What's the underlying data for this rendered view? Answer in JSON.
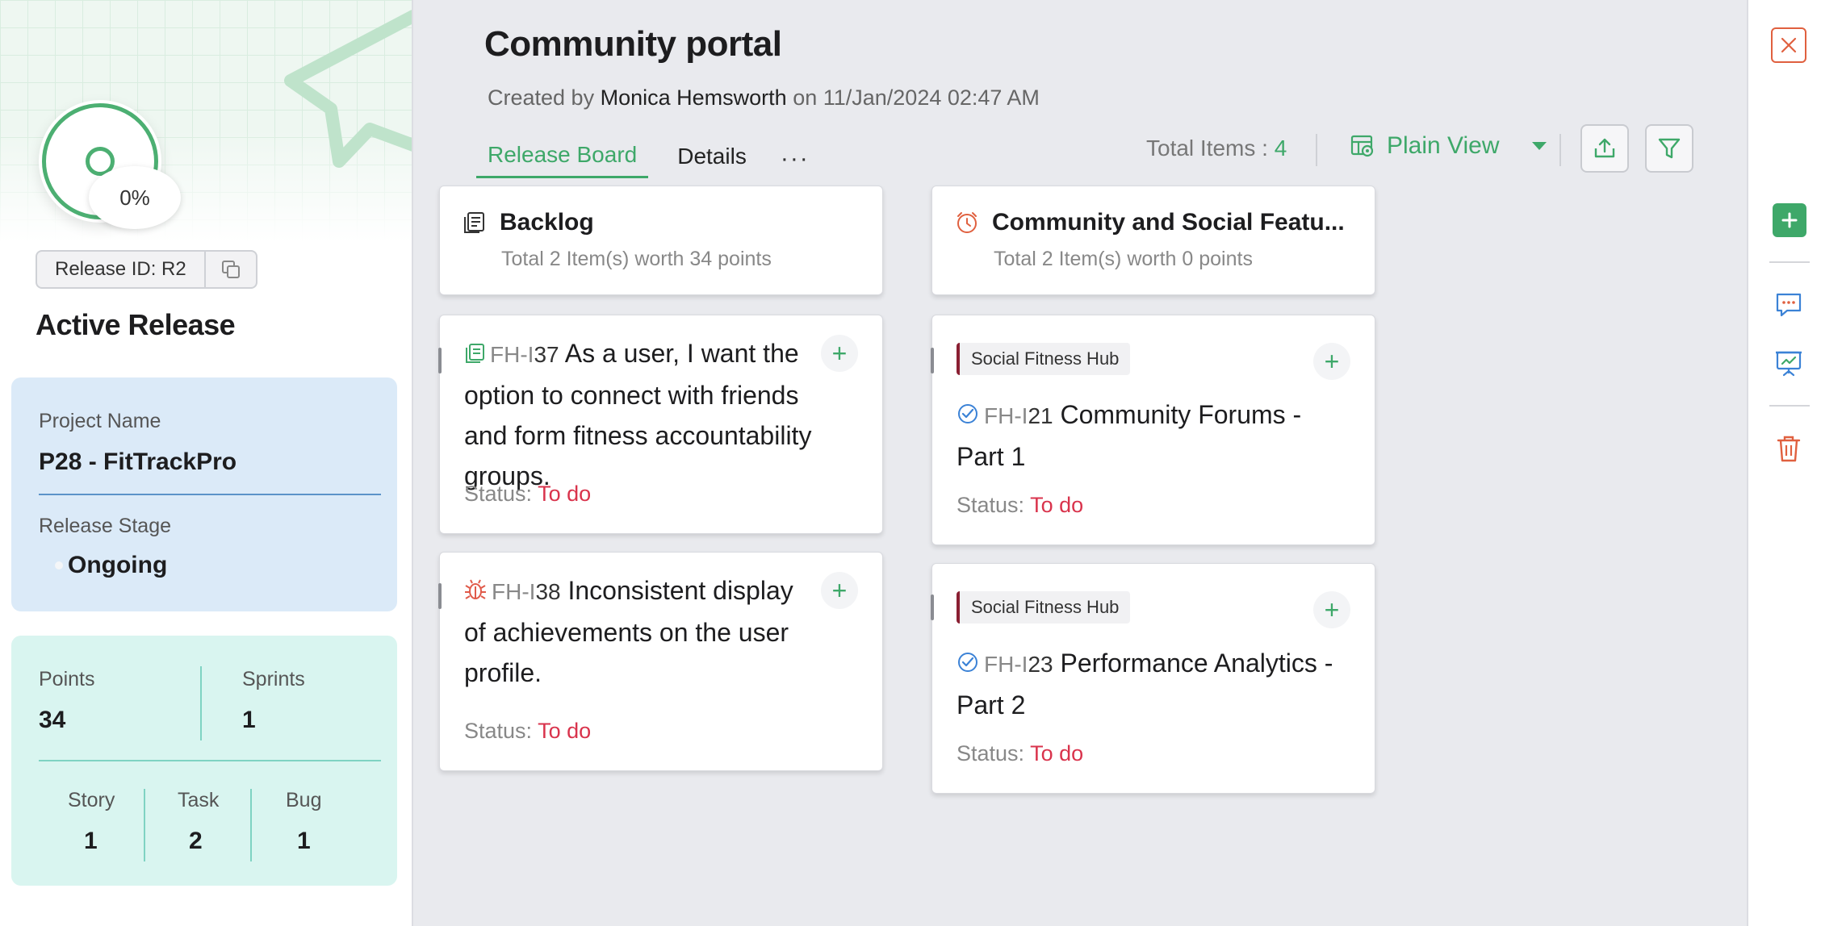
{
  "release": {
    "progress_pct": "0%",
    "progress_value": 0,
    "release_id": "Release ID: R2",
    "heading": "Active Release",
    "project_name_label": "Project Name",
    "project_name": "P28 - FitTrackPro",
    "stage_label": "Release Stage",
    "stage": "Ongoing",
    "points_label": "Points",
    "points": "34",
    "sprints_label": "Sprints",
    "sprints": "1",
    "story_label": "Story",
    "story": "1",
    "task_label": "Task",
    "task": "2",
    "bug_label": "Bug",
    "bug": "1"
  },
  "header": {
    "title": "Community portal",
    "created_prefix": "Created by",
    "created_by": "Monica Hemsworth",
    "created_suffix": "on 11/Jan/2024 02:47 AM",
    "tabs": [
      {
        "label": "Release Board",
        "active": true
      },
      {
        "label": "Details",
        "active": false
      }
    ],
    "more": "···",
    "total_label": "Total Items :",
    "total_value": "4",
    "view_label": "Plain View"
  },
  "columns": [
    {
      "name": "Backlog",
      "summary": "Total 2 Item(s) worth 34 points",
      "icon": "backlog-icon",
      "cards": [
        {
          "type_icon": "story-icon",
          "key": "FH-I",
          "num": "37",
          "title": "As a user, I want the option to connect with friends and form fitness accountability groups.",
          "status_label": "Status:",
          "status": "To do"
        },
        {
          "type_icon": "bug-icon",
          "key": "FH-I",
          "num": "38",
          "title": "Inconsistent display of achievements on the user profile.",
          "status_label": "Status:",
          "status": "To do"
        }
      ]
    },
    {
      "name": "Community and Social Featu...",
      "summary": "Total 2 Item(s) worth 0 points",
      "icon": "sprint-clock-icon",
      "cards": [
        {
          "tag": "Social Fitness Hub",
          "type_icon": "task-icon",
          "key": "FH-I",
          "num": "21",
          "title": "Community Forums - Part 1",
          "status_label": "Status:",
          "status": "To do"
        },
        {
          "tag": "Social Fitness Hub",
          "type_icon": "task-icon",
          "key": "FH-I",
          "num": "23",
          "title": "Performance Analytics - Part 2",
          "status_label": "Status:",
          "status": "To do"
        }
      ]
    }
  ],
  "colors": {
    "accent": "#3ea869",
    "status_todo": "#d9334c",
    "project_card": "#dbeaf8",
    "stats_card": "#d9f5f0",
    "close": "#e0603f"
  }
}
